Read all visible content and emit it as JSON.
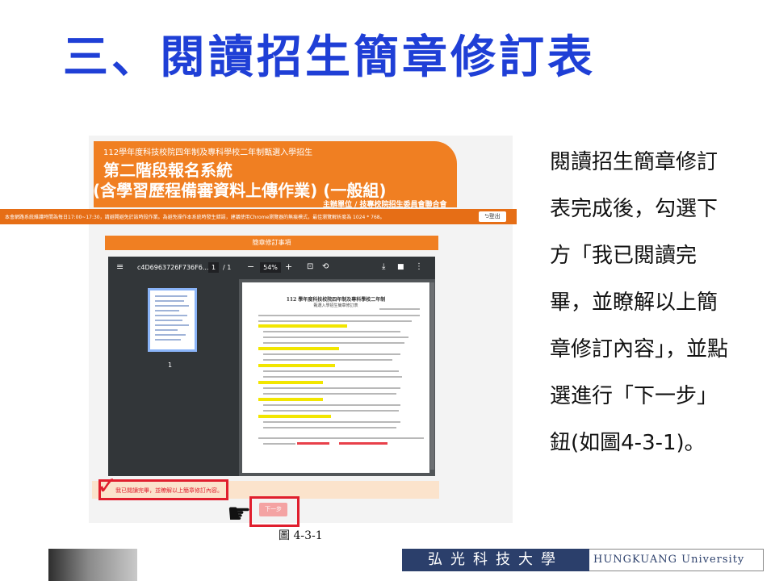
{
  "slide": {
    "title": "三、閱讀招生簡章修訂表",
    "explanation": "閱讀招生簡章修訂表完成後，勾選下方「我已閱讀完畢，並瞭解以上簡章修訂內容」，並點選進行「下一步」鈕(如圖4-3-1)。",
    "figure_caption": "圖 4-3-1"
  },
  "screenshot": {
    "banner": {
      "line1": "112學年度科技校院四年制及專科學校二年制甄選入學招生",
      "line2": "第二階段報名系統",
      "line3": "(含學習歷程備審資料上傳作業) (一般組)",
      "organizer": "主辦單位 / 技專校院招生委員會聯合會"
    },
    "notice": "本會網路系統維護時間為每日17:00~17:30，請避開避免於該時段作業。為避免操作本系統時發生錯誤，建議使用Chrome瀏覽器的無痕模式，最佳瀏覽解析度為 1024 * 768。",
    "logout_label": "登出",
    "section_title": "簡章修訂事項",
    "pdf": {
      "filename": "c4D6963726F736F6...",
      "page_current": "1",
      "page_total": "/ 1",
      "zoom": "54%",
      "thumbnail_label": "1",
      "doc_title": "112 學年度科技校院四年制及專科學校二年制",
      "doc_subtitle": "甄選入學招生簡章修訂表"
    },
    "confirm_label": "我已閱讀完畢，並瞭解以上簡章修訂內容。",
    "next_label": "下一步"
  },
  "footer": {
    "school_cn": "弘光科技大學",
    "school_en": "HUNGKUANG University"
  },
  "colors": {
    "title_blue": "#1f3fd6",
    "banner_orange": "#f07f22",
    "highlight_red": "#e01e2d"
  }
}
